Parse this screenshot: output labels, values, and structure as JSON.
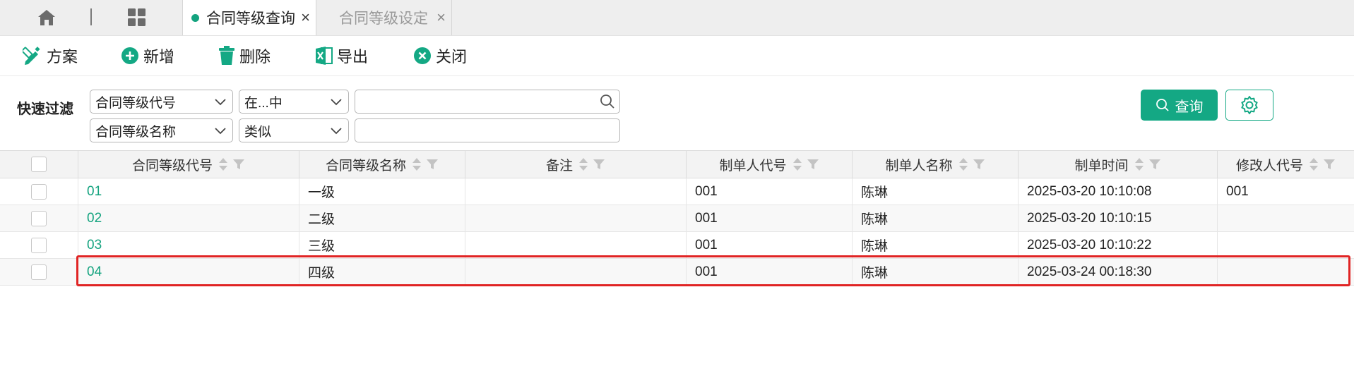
{
  "tabs": [
    {
      "label": "合同等级查询",
      "active": true,
      "close": "×"
    },
    {
      "label": "合同等级设定",
      "active": false,
      "close": "×"
    }
  ],
  "toolbar": {
    "scheme": "方案",
    "add": "新增",
    "delete": "删除",
    "export": "导出",
    "close": "关闭"
  },
  "filter": {
    "label": "快速过滤",
    "row1": {
      "field": "合同等级代号",
      "operator": "在...中",
      "value": ""
    },
    "row2": {
      "field": "合同等级名称",
      "operator": "类似",
      "value": ""
    },
    "query_label": "查询"
  },
  "table": {
    "columns": [
      "合同等级代号",
      "合同等级名称",
      "备注",
      "制单人代号",
      "制单人名称",
      "制单时间",
      "修改人代号"
    ],
    "rows": [
      {
        "code": "01",
        "name": "一级",
        "remark": "",
        "creator_code": "001",
        "creator_name": "陈琳",
        "created_at": "2025-03-20 10:10:08",
        "modifier_code": "001"
      },
      {
        "code": "02",
        "name": "二级",
        "remark": "",
        "creator_code": "001",
        "creator_name": "陈琳",
        "created_at": "2025-03-20 10:10:15",
        "modifier_code": ""
      },
      {
        "code": "03",
        "name": "三级",
        "remark": "",
        "creator_code": "001",
        "creator_name": "陈琳",
        "created_at": "2025-03-20 10:10:22",
        "modifier_code": ""
      },
      {
        "code": "04",
        "name": "四级",
        "remark": "",
        "creator_code": "001",
        "creator_name": "陈琳",
        "created_at": "2025-03-24 00:18:30",
        "modifier_code": ""
      }
    ]
  },
  "colors": {
    "accent": "#14a884",
    "highlight": "#e02424"
  }
}
